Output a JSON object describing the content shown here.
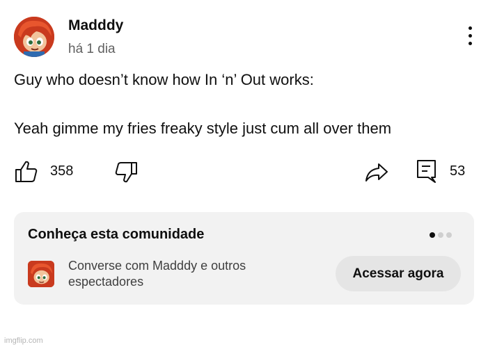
{
  "comment": {
    "author": "Madddy",
    "timestamp": "há 1 dia",
    "line1": "Guy who doesn’t know how In ‘n’ Out works:",
    "line2": "Yeah gimme my fries freaky style just cum all over them"
  },
  "actions": {
    "likes": "358",
    "replies": "53",
    "like_icon": "thumbs-up-icon",
    "dislike_icon": "thumbs-down-icon",
    "share_icon": "share-icon",
    "reply_icon": "comment-icon"
  },
  "community_card": {
    "title": "Conheça esta comunidade",
    "description": "Converse com Madddy e outros espectadores",
    "button_label": "Acessar agora",
    "pager_total": 3,
    "pager_active": 1
  },
  "watermark": "imgflip.com",
  "colors": {
    "avatar_red": "#d84a2a",
    "card_bg": "#f2f2f2",
    "button_bg": "#e5e5e5",
    "secondary_text": "#606060"
  }
}
